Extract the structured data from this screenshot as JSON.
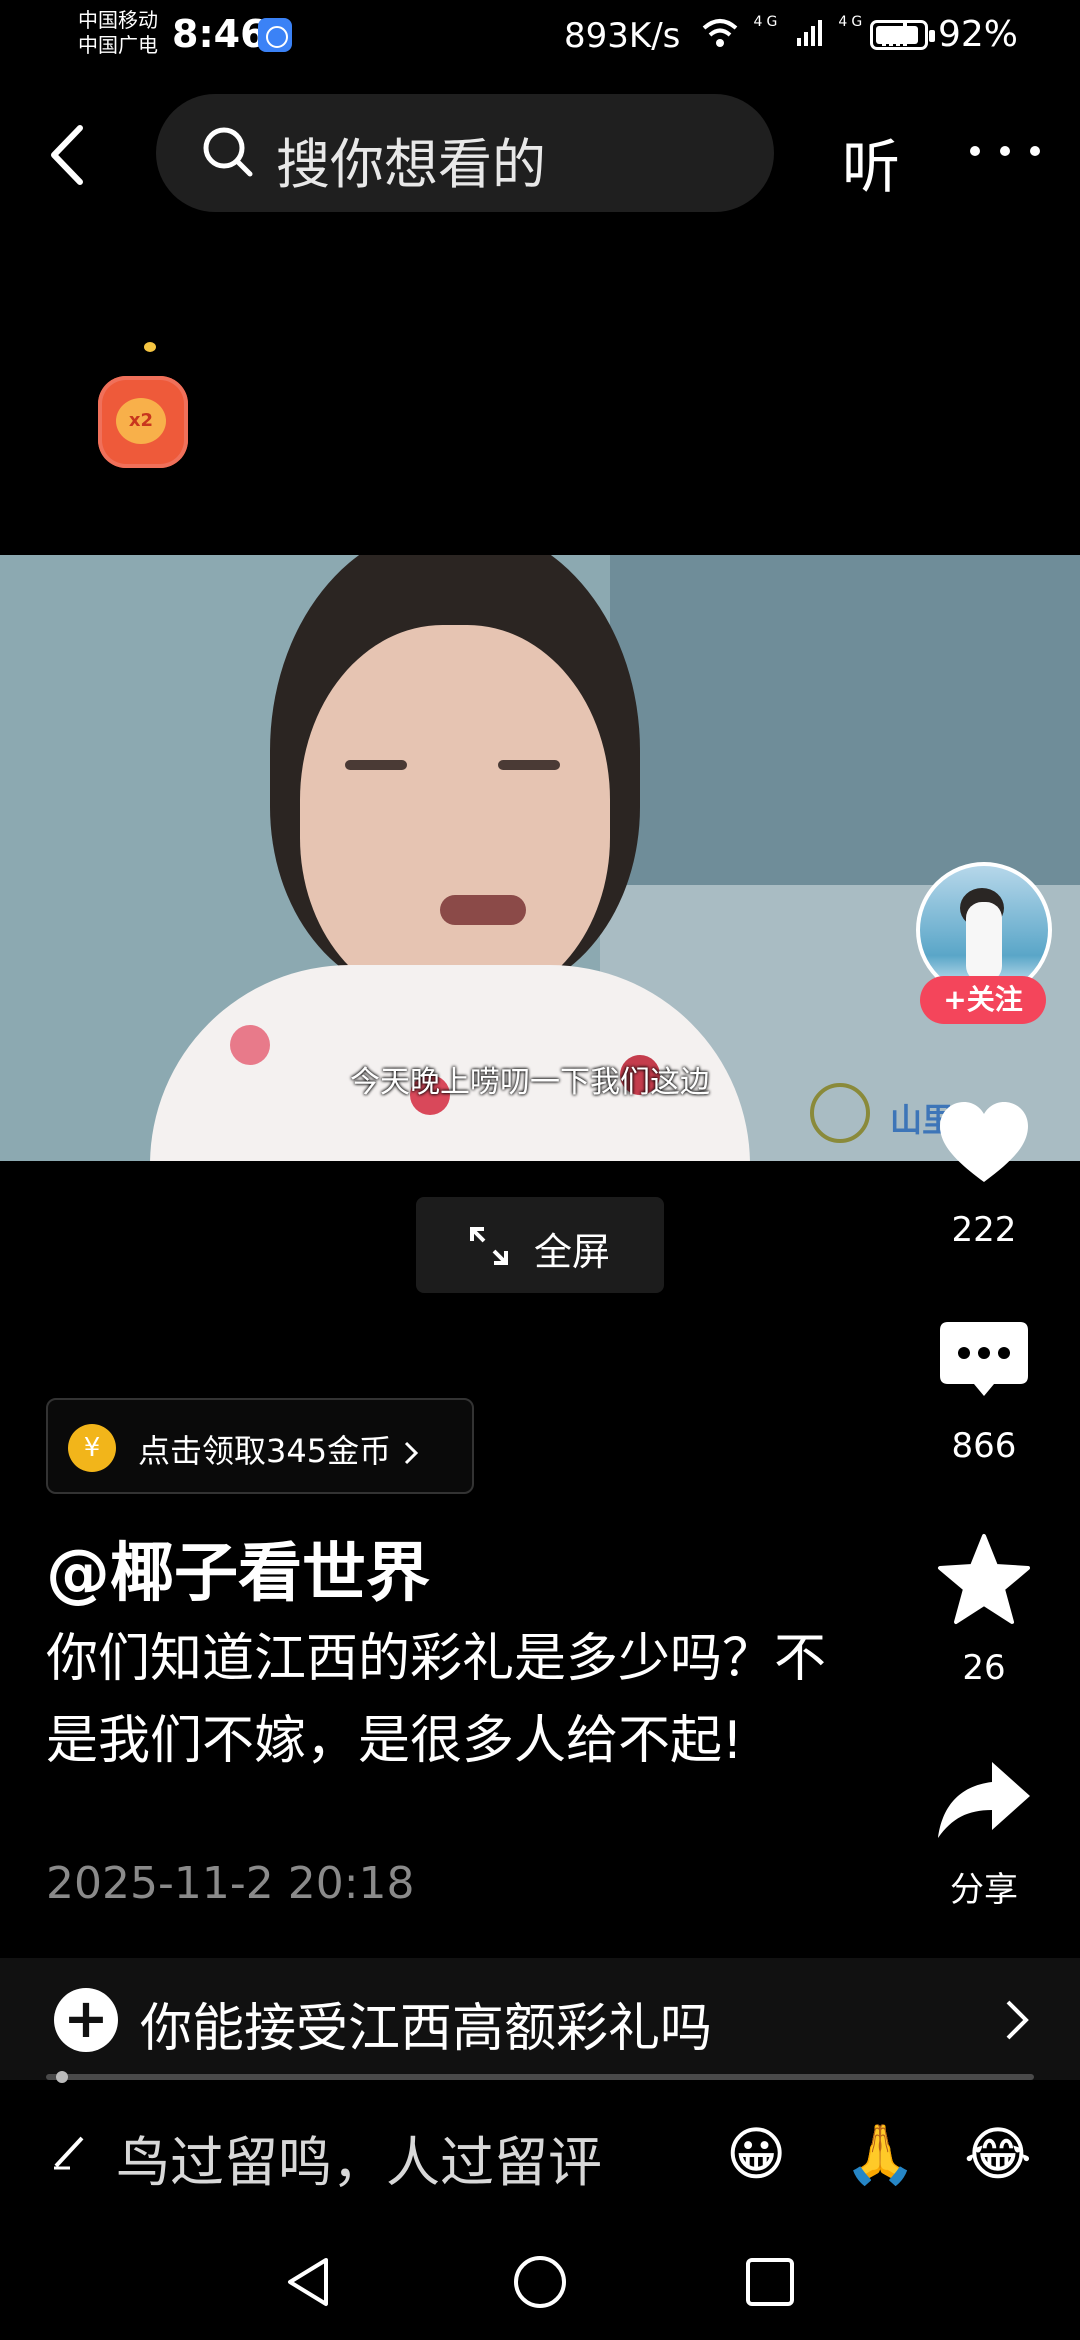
{
  "status_bar": {
    "carrier_1": "中国移动",
    "carrier_2": "中国广电",
    "time": "8:46",
    "net_speed": "893K/s",
    "signal_label": "4G",
    "battery_percent_text": "92%",
    "battery_level": 0.92
  },
  "top_bar": {
    "search_placeholder": "搜你想看的",
    "listen_label": "听"
  },
  "video": {
    "subtitle": "今天晚上唠叨一下我们这边",
    "watermark": "山里"
  },
  "side_actions": {
    "follow_label": "+关注",
    "like_count": "222",
    "comment_count": "866",
    "favorite_count": "26",
    "share_label": "分享"
  },
  "fullscreen_label": "全屏",
  "coin_reward": {
    "text": "点击领取345金币",
    "icon": "¥"
  },
  "post": {
    "author": "@椰子看世界",
    "description": "你们知道江西的彩礼是多少吗？不是我们不嫁，是很多人给不起!",
    "date": "2025-11-2 20:18"
  },
  "topic": {
    "label": "你能接受江西高额彩礼吗"
  },
  "playback_progress": 0.01,
  "comment_bar": {
    "placeholder": "鸟过留鸣，人过留评",
    "emojis": [
      "😀",
      "🙏",
      "😂"
    ]
  },
  "colors": {
    "background": "#000000",
    "follow_button": "#f4455b",
    "coin": "#f2b51a",
    "red_packet": "#ee5a3a"
  }
}
